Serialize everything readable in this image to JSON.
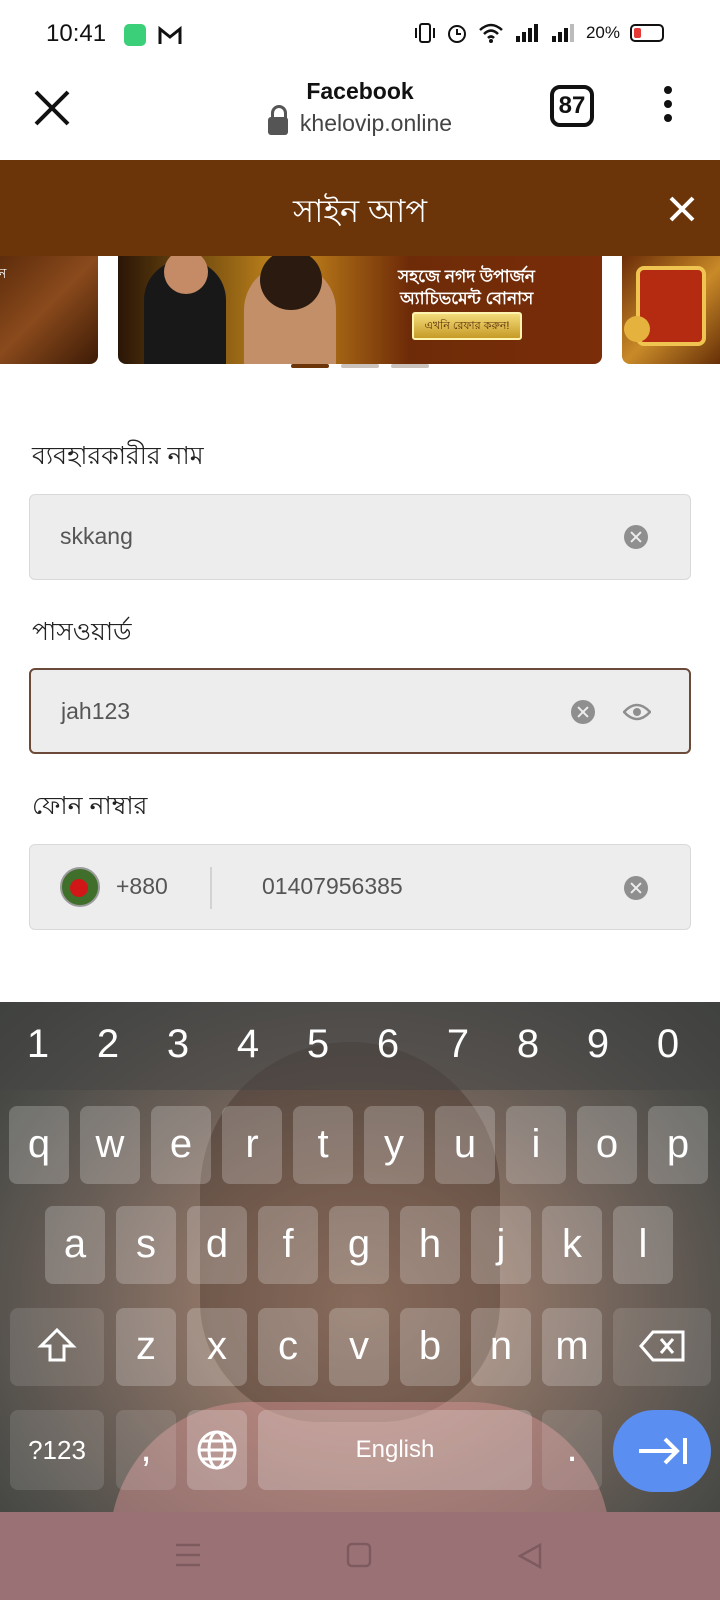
{
  "status_bar": {
    "time": "10:41",
    "battery_percent": "20%",
    "icons": [
      "app-icon-green",
      "gmail-icon",
      "vibrate-icon",
      "alarm-icon",
      "wifi-icon",
      "signal-icon",
      "signal-icon-2",
      "battery-icon"
    ]
  },
  "browser": {
    "title": "Facebook",
    "url": "khelovip.online",
    "tab_count": "87"
  },
  "signup": {
    "title": "সাইন আপ"
  },
  "carousel": {
    "slide_left_text": "ন",
    "slide_main_line1": "সহজে নগদ উপার্জন",
    "slide_main_line2": "অ্যাচিভমেন্ট বোনাস",
    "slide_main_button": "এখনি রেফার করুন!",
    "active_index": 0,
    "dot_count": 3
  },
  "form": {
    "username_label": "ব্যবহারকারীর নাম",
    "username_value": "skkang",
    "password_label": "পাসওয়ার্ড",
    "password_value": "jah123",
    "phone_label": "ফোন নাম্বার",
    "country_code": "+880",
    "phone_value": "01407956385"
  },
  "keyboard": {
    "number_row": [
      "1",
      "2",
      "3",
      "4",
      "5",
      "6",
      "7",
      "8",
      "9",
      "0"
    ],
    "row1": [
      "q",
      "w",
      "e",
      "r",
      "t",
      "y",
      "u",
      "i",
      "o",
      "p"
    ],
    "row2": [
      "a",
      "s",
      "d",
      "f",
      "g",
      "h",
      "j",
      "k",
      "l"
    ],
    "row3": [
      "z",
      "x",
      "c",
      "v",
      "b",
      "n",
      "m"
    ],
    "symbols_label": "?123",
    "comma": ",",
    "space_label": "English",
    "period": "."
  },
  "colors": {
    "brand_brown": "#6b3409",
    "go_key_blue": "#5b8ef1",
    "nav_bar": "#9a7276"
  }
}
